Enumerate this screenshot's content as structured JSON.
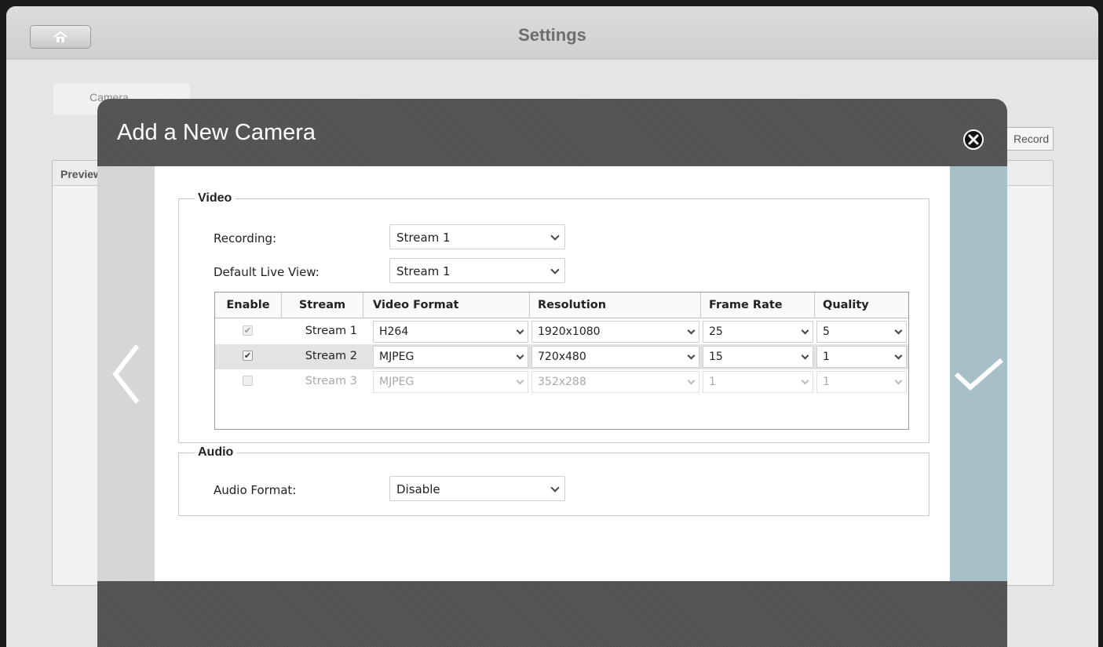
{
  "app": {
    "title": "Settings",
    "tab_label": "Camera",
    "record_button": "Record",
    "panel_header": "Preview"
  },
  "modal": {
    "title": "Add a New Camera",
    "video": {
      "legend": "Video",
      "recording_label": "Recording:",
      "recording_value": "Stream 1",
      "live_view_label": "Default Live View:",
      "live_view_value": "Stream 1",
      "table": {
        "headers": [
          "Enable",
          "Stream",
          "Video Format",
          "Resolution",
          "Frame Rate",
          "Quality"
        ],
        "rows": [
          {
            "enabled": true,
            "stream": "Stream 1",
            "format": "H264",
            "resolution": "1920x1080",
            "frame_rate": "25",
            "quality": "5"
          },
          {
            "enabled": true,
            "stream": "Stream 2",
            "format": "MJPEG",
            "resolution": "720x480",
            "frame_rate": "15",
            "quality": "1"
          },
          {
            "enabled": false,
            "stream": "Stream 3",
            "format": "MJPEG",
            "resolution": "352x288",
            "frame_rate": "1",
            "quality": "1"
          }
        ]
      }
    },
    "audio": {
      "legend": "Audio",
      "format_label": "Audio Format:",
      "format_value": "Disable"
    }
  },
  "colors": {
    "modal_header": "#555555",
    "next_panel": "#a7c0c7",
    "prev_panel": "#d6d6d6"
  },
  "icons": {
    "home": "home-icon",
    "close": "close-icon",
    "prev": "chevron-left-icon",
    "next": "checkmark-icon"
  }
}
